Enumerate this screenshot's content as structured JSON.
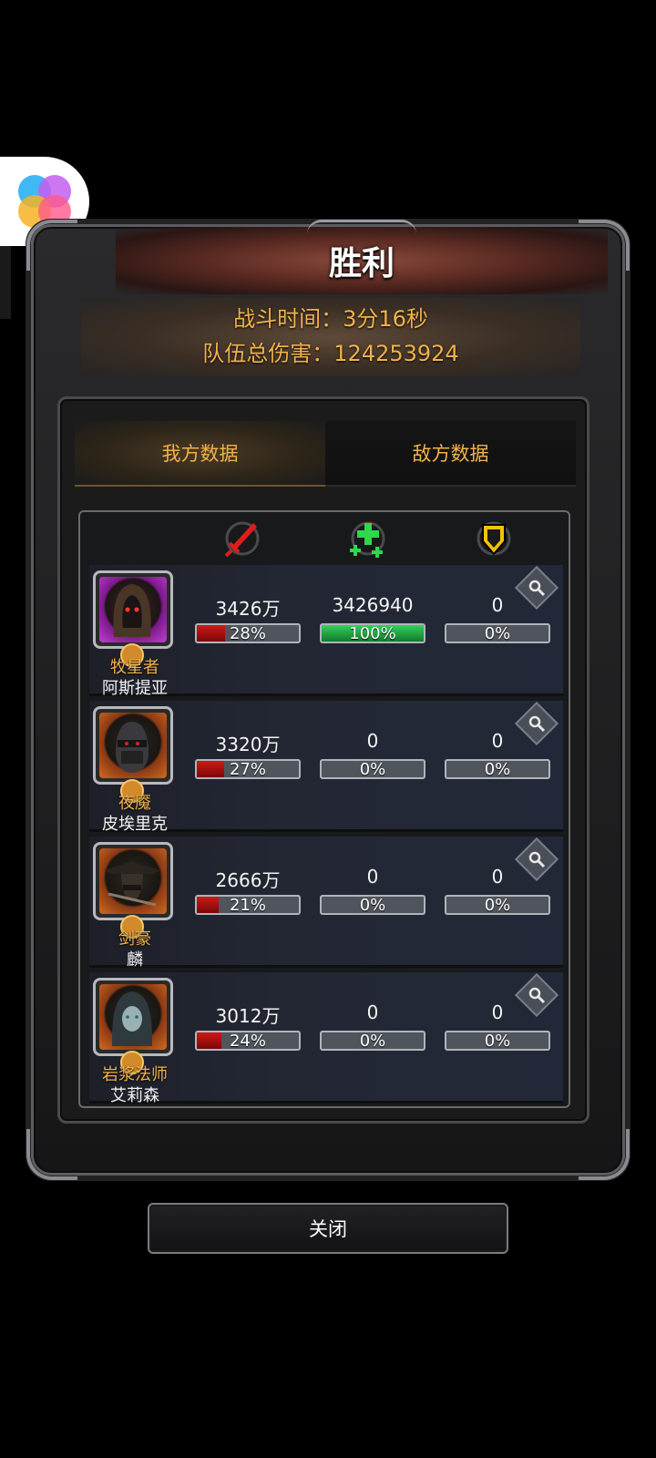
{
  "window": {
    "title": "胜利"
  },
  "battle_stats": {
    "time_line": "战斗时间：3分16秒",
    "damage_line": "队伍总伤害：124253924"
  },
  "tabs": [
    {
      "label": "我方数据",
      "active": true
    },
    {
      "label": "敌方数据",
      "active": false
    }
  ],
  "columns": [
    {
      "icon": "sword-icon",
      "color": "#e01c1c"
    },
    {
      "icon": "heal-cross-icon",
      "color": "#2fd84a"
    },
    {
      "icon": "shield-icon",
      "color": "#f2c400"
    }
  ],
  "heroes": [
    {
      "class": "牧星者",
      "name": "阿斯提亚",
      "frame_color": "#c040d0",
      "damage": "3426万",
      "damage_pct": "28%",
      "damage_fill": 0.28,
      "heal": "3426940",
      "heal_pct": "100%",
      "heal_fill": 1.0,
      "defense": "0",
      "defense_pct": "0%",
      "defense_fill": 0
    },
    {
      "class": "夜魇",
      "name": "皮埃里克",
      "frame_color": "#d06a22",
      "damage": "3320万",
      "damage_pct": "27%",
      "damage_fill": 0.27,
      "heal": "0",
      "heal_pct": "0%",
      "heal_fill": 0,
      "defense": "0",
      "defense_pct": "0%",
      "defense_fill": 0
    },
    {
      "class": "剑豪",
      "name": "麟",
      "frame_color": "#d06a22",
      "damage": "2666万",
      "damage_pct": "21%",
      "damage_fill": 0.21,
      "heal": "0",
      "heal_pct": "0%",
      "heal_fill": 0,
      "defense": "0",
      "defense_pct": "0%",
      "defense_fill": 0
    },
    {
      "class": "岩浆法师",
      "name": "艾莉森",
      "frame_color": "#d06a22",
      "damage": "3012万",
      "damage_pct": "24%",
      "damage_fill": 0.24,
      "heal": "0",
      "heal_pct": "0%",
      "heal_fill": 0,
      "defense": "0",
      "defense_pct": "0%",
      "defense_fill": 0
    }
  ],
  "close_button": {
    "label": "关闭"
  }
}
